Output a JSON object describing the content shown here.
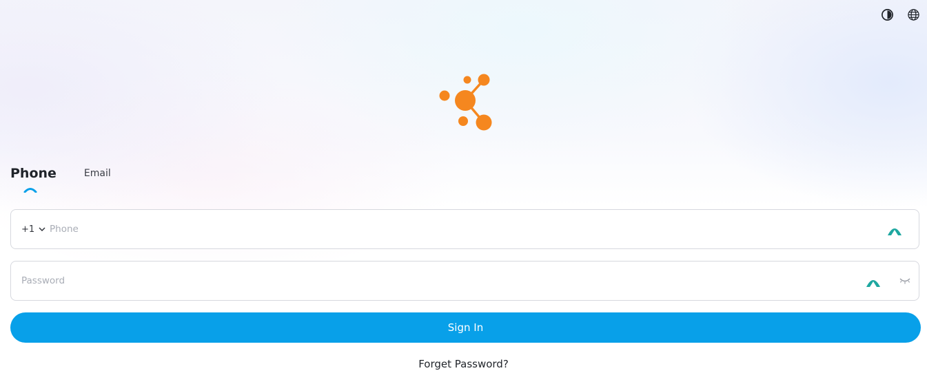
{
  "header": {
    "theme_icon": "contrast-icon",
    "language_icon": "globe-icon"
  },
  "brand": {
    "logo": "molecule-logo",
    "logo_color": "#f5871f"
  },
  "tabs": [
    {
      "label": "Phone",
      "active": true
    },
    {
      "label": "Email",
      "active": false
    }
  ],
  "form": {
    "phone": {
      "country_code": "+1",
      "placeholder": "Phone",
      "value": ""
    },
    "password": {
      "placeholder": "Password",
      "value": ""
    },
    "sign_in_label": "Sign In",
    "forget_password_label": "Forget Password?"
  },
  "colors": {
    "accent": "#08a0e9",
    "extension_icon": "#1ea7a0"
  }
}
